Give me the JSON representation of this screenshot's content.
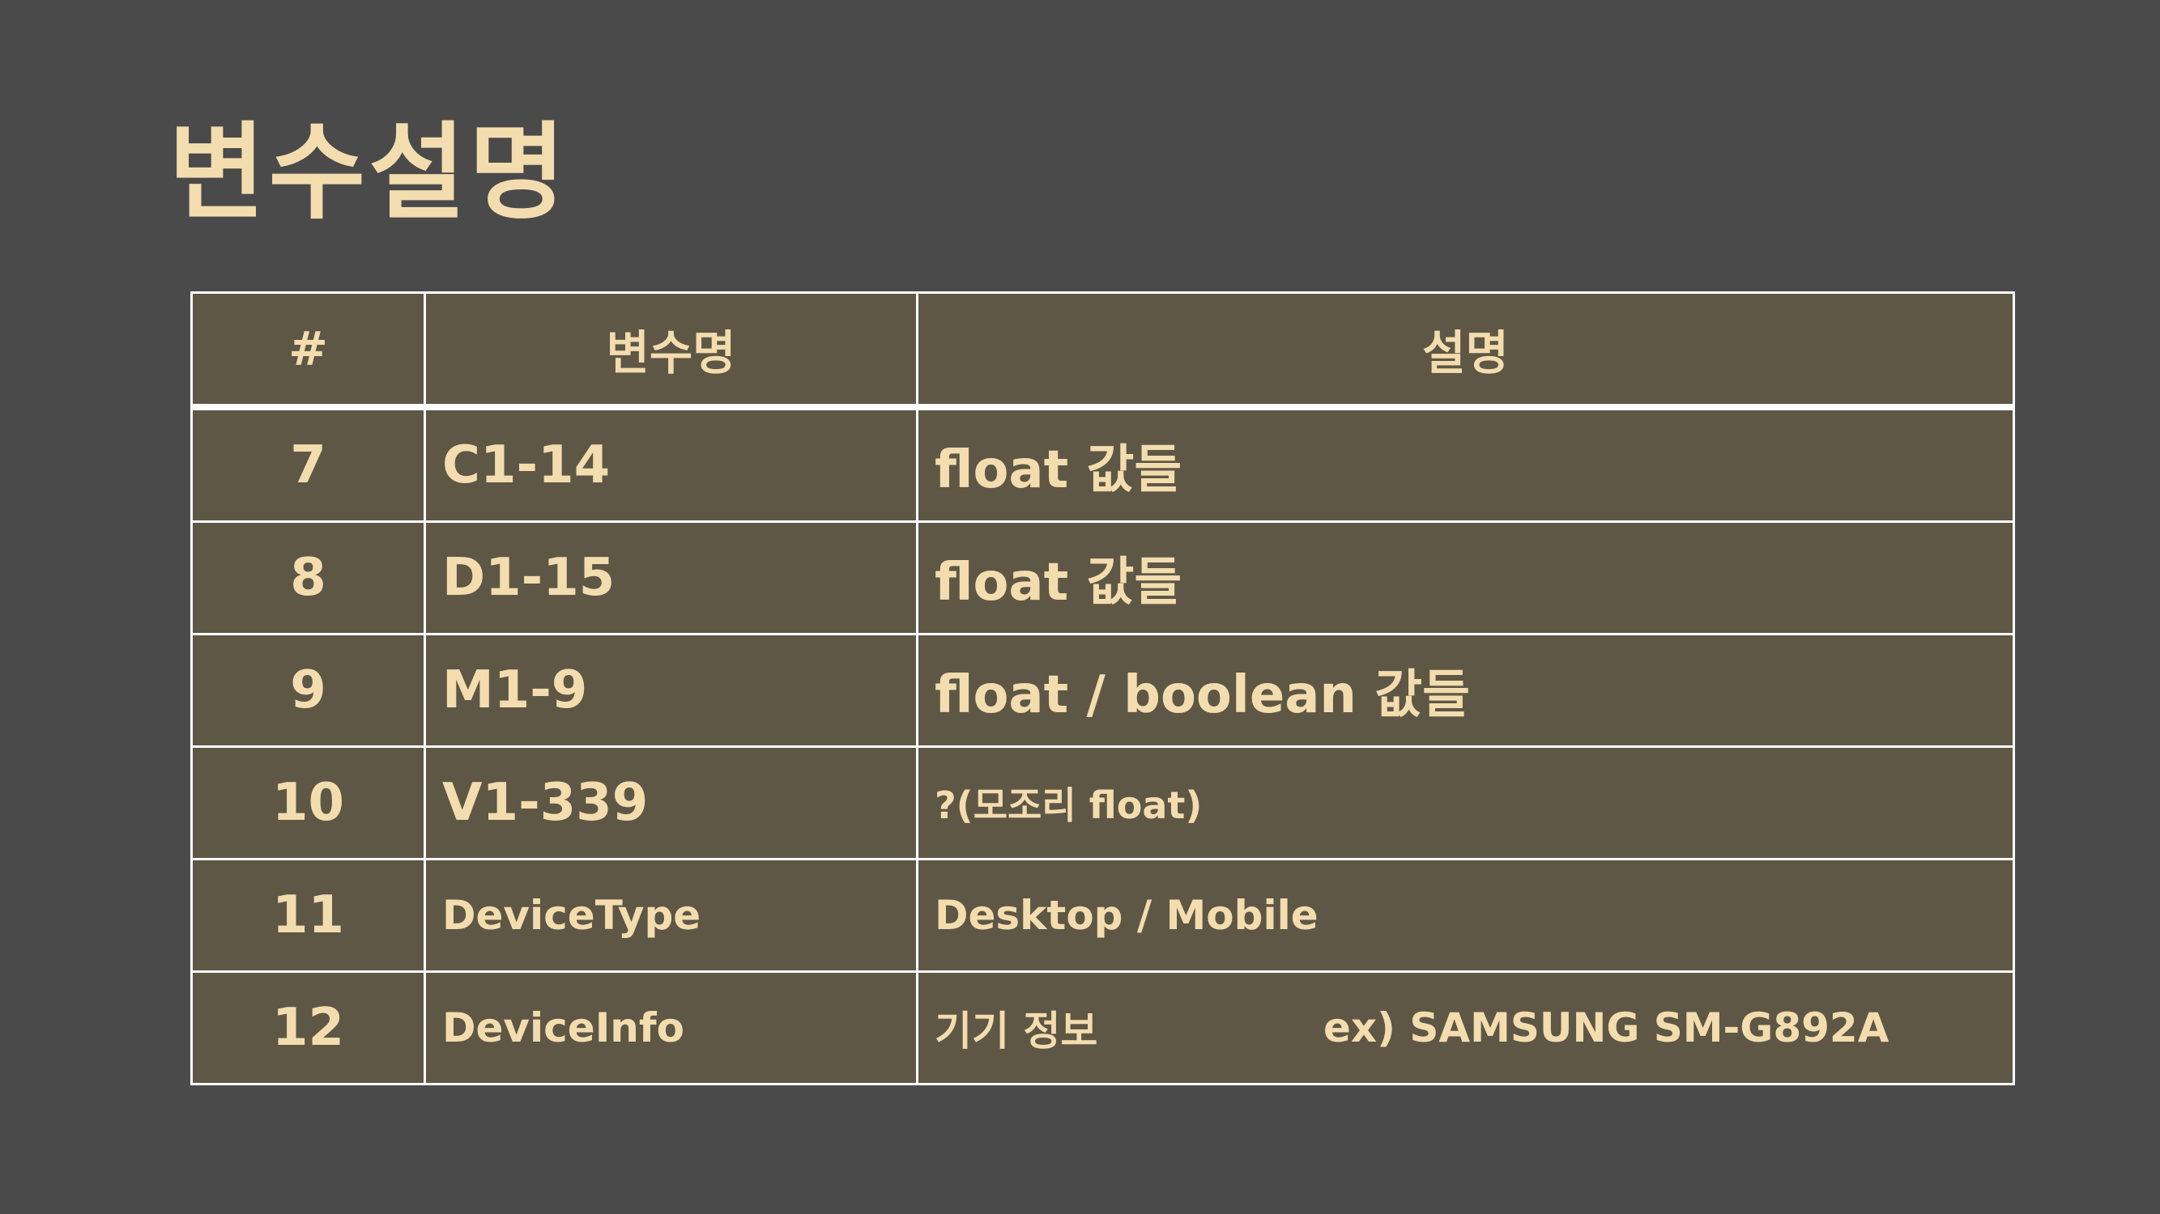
{
  "slide": {
    "title": "변수설명"
  },
  "table": {
    "headers": [
      "#",
      "변수명",
      "설명"
    ],
    "rows": [
      {
        "num": "7",
        "name": "C1-14",
        "desc": "float 값들"
      },
      {
        "num": "8",
        "name": "D1-15",
        "desc": "float 값들"
      },
      {
        "num": "9",
        "name": "M1-9",
        "desc": "float / boolean 값들"
      },
      {
        "num": "10",
        "name": "V1-339",
        "desc": "?(모조리 float)"
      },
      {
        "num": "11",
        "name": "DeviceType",
        "desc": "Desktop / Mobile"
      },
      {
        "num": "12",
        "name": "DeviceInfo",
        "desc": "기기 정보",
        "example": "ex) SAMSUNG SM-G892A"
      }
    ]
  },
  "colors": {
    "background": "#4a4a4a",
    "table_fill": "#5e5745",
    "text": "#f3dcae",
    "border": "#ffffff"
  }
}
